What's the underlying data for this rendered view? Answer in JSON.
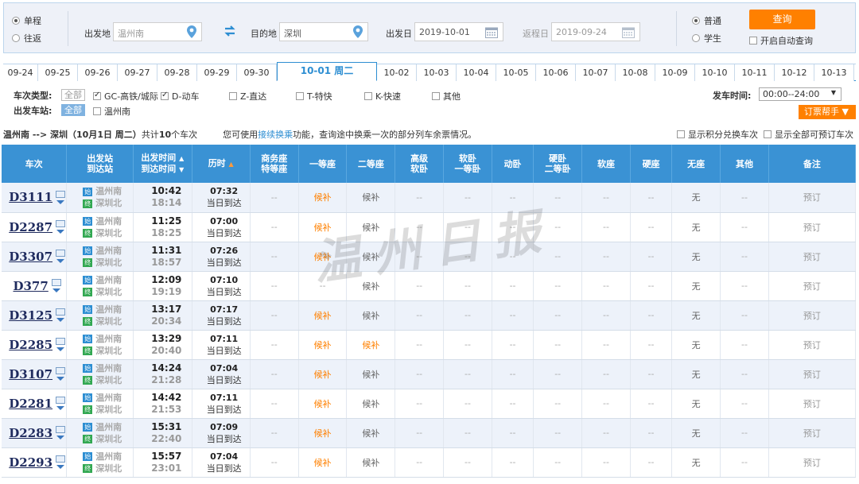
{
  "search": {
    "trip_type": [
      {
        "label": "单程",
        "selected": true
      },
      {
        "label": "往返",
        "selected": false
      }
    ],
    "from_label": "出发地",
    "from_value": "温州南",
    "to_label": "目的地",
    "to_value": "深圳",
    "depart_label": "出发日",
    "depart_value": "2019-10-01",
    "return_label": "返程日",
    "return_value": "2019-09-24",
    "passenger_type": [
      {
        "label": "普通",
        "selected": true
      },
      {
        "label": "学生",
        "selected": false
      }
    ],
    "query_button": "查询",
    "auto_query_label": "开启自动查询"
  },
  "date_tabs": [
    {
      "label": "09-24",
      "active": false
    },
    {
      "label": "09-25",
      "active": false
    },
    {
      "label": "09-26",
      "active": false
    },
    {
      "label": "09-27",
      "active": false
    },
    {
      "label": "09-28",
      "active": false
    },
    {
      "label": "09-29",
      "active": false
    },
    {
      "label": "09-30",
      "active": false
    },
    {
      "label": "10-01 周二",
      "active": true
    },
    {
      "label": "10-02",
      "active": false
    },
    {
      "label": "10-03",
      "active": false
    },
    {
      "label": "10-04",
      "active": false
    },
    {
      "label": "10-05",
      "active": false
    },
    {
      "label": "10-06",
      "active": false
    },
    {
      "label": "10-07",
      "active": false
    },
    {
      "label": "10-08",
      "active": false
    },
    {
      "label": "10-09",
      "active": false
    },
    {
      "label": "10-10",
      "active": false
    },
    {
      "label": "10-11",
      "active": false
    },
    {
      "label": "10-12",
      "active": false
    },
    {
      "label": "10-13",
      "active": false
    }
  ],
  "filters": {
    "train_type_label": "车次类型:",
    "all_label": "全部",
    "train_types": [
      {
        "label": "GC-高铁/城际",
        "checked": true
      },
      {
        "label": "D-动车",
        "checked": true
      },
      {
        "label": "Z-直达",
        "checked": false
      },
      {
        "label": "T-特快",
        "checked": false
      },
      {
        "label": "K-快速",
        "checked": false
      },
      {
        "label": "其他",
        "checked": false
      }
    ],
    "station_label": "出发车站:",
    "stations": [
      {
        "label": "温州南",
        "checked": false
      }
    ],
    "depart_time_label": "发车时间:",
    "depart_time_value": "00:00--24:00",
    "helper_button": "订票帮手"
  },
  "summary": {
    "route": "温州南 --> 深圳（10月1日 周二）",
    "count_prefix": "共计",
    "count": "10",
    "count_suffix": "个车次",
    "tip_prefix": "您可使用",
    "tip_link": "接续换乘",
    "tip_suffix": "功能，查询途中换乘一次的部分列车余票情况。",
    "show_points_label": "显示积分兑换车次",
    "show_all_label": "显示全部可预订车次"
  },
  "table": {
    "headers": {
      "train": "车次",
      "station_1": "出发站",
      "station_2": "到达站",
      "time_1": "出发时间",
      "time_2": "到达时间",
      "duration": "历时",
      "business_1": "商务座",
      "business_2": "特等座",
      "first": "一等座",
      "second": "二等座",
      "adv_1": "高级",
      "adv_2": "软卧",
      "soft_1": "软卧",
      "soft_2": "一等卧",
      "dongwo": "动卧",
      "hard_1": "硬卧",
      "hard_2": "二等卧",
      "soft_seat": "软座",
      "hard_seat": "硬座",
      "no_seat": "无座",
      "other": "其他",
      "note": "备注"
    },
    "start_badge": "始",
    "end_badge": "终",
    "rows": [
      {
        "train": "D3111",
        "from": "温州南",
        "to": "深圳北",
        "dep": "10:42",
        "arr": "18:14",
        "dur": "07:32",
        "arrive_day": "当日到达",
        "first": "候补",
        "second": "候补",
        "no_seat": "无",
        "note": "预订"
      },
      {
        "train": "D2287",
        "from": "温州南",
        "to": "深圳北",
        "dep": "11:25",
        "arr": "18:25",
        "dur": "07:00",
        "arrive_day": "当日到达",
        "first": "候补",
        "second": "候补",
        "no_seat": "无",
        "note": "预订"
      },
      {
        "train": "D3307",
        "from": "温州南",
        "to": "深圳北",
        "dep": "11:31",
        "arr": "18:57",
        "dur": "07:26",
        "arrive_day": "当日到达",
        "first": "候补",
        "second": "候补",
        "no_seat": "无",
        "note": "预订"
      },
      {
        "train": "D377",
        "from": "温州南",
        "to": "深圳北",
        "dep": "12:09",
        "arr": "19:19",
        "dur": "07:10",
        "arrive_day": "当日到达",
        "first": "--",
        "second": "候补",
        "no_seat": "无",
        "note": "预订"
      },
      {
        "train": "D3125",
        "from": "温州南",
        "to": "深圳北",
        "dep": "13:17",
        "arr": "20:34",
        "dur": "07:17",
        "arrive_day": "当日到达",
        "first": "候补",
        "second": "候补",
        "no_seat": "无",
        "note": "预订"
      },
      {
        "train": "D2285",
        "from": "温州南",
        "to": "深圳北",
        "dep": "13:29",
        "arr": "20:40",
        "dur": "07:11",
        "arrive_day": "当日到达",
        "first": "候补",
        "second": "候补",
        "no_seat": "无",
        "note": "预订"
      },
      {
        "train": "D3107",
        "from": "温州南",
        "to": "深圳北",
        "dep": "14:24",
        "arr": "21:28",
        "dur": "07:04",
        "arrive_day": "当日到达",
        "first": "候补",
        "second": "候补",
        "no_seat": "无",
        "note": "预订"
      },
      {
        "train": "D2281",
        "from": "温州南",
        "to": "深圳北",
        "dep": "14:42",
        "arr": "21:53",
        "dur": "07:11",
        "arrive_day": "当日到达",
        "first": "候补",
        "second": "候补",
        "no_seat": "无",
        "note": "预订"
      },
      {
        "train": "D2283",
        "from": "温州南",
        "to": "深圳北",
        "dep": "15:31",
        "arr": "22:40",
        "dur": "07:09",
        "arrive_day": "当日到达",
        "first": "候补",
        "second": "候补",
        "no_seat": "无",
        "note": "预订"
      },
      {
        "train": "D2293",
        "from": "温州南",
        "to": "深圳北",
        "dep": "15:57",
        "arr": "23:01",
        "dur": "07:04",
        "arrive_day": "当日到达",
        "first": "候补",
        "second": "候补",
        "no_seat": "无",
        "note": "预订"
      }
    ],
    "empty": "--"
  },
  "watermark": "温州日报",
  "colors": {
    "accent": "#ff8000",
    "header_blue": "#3a92d4",
    "train_code": "#1f2b5e"
  }
}
